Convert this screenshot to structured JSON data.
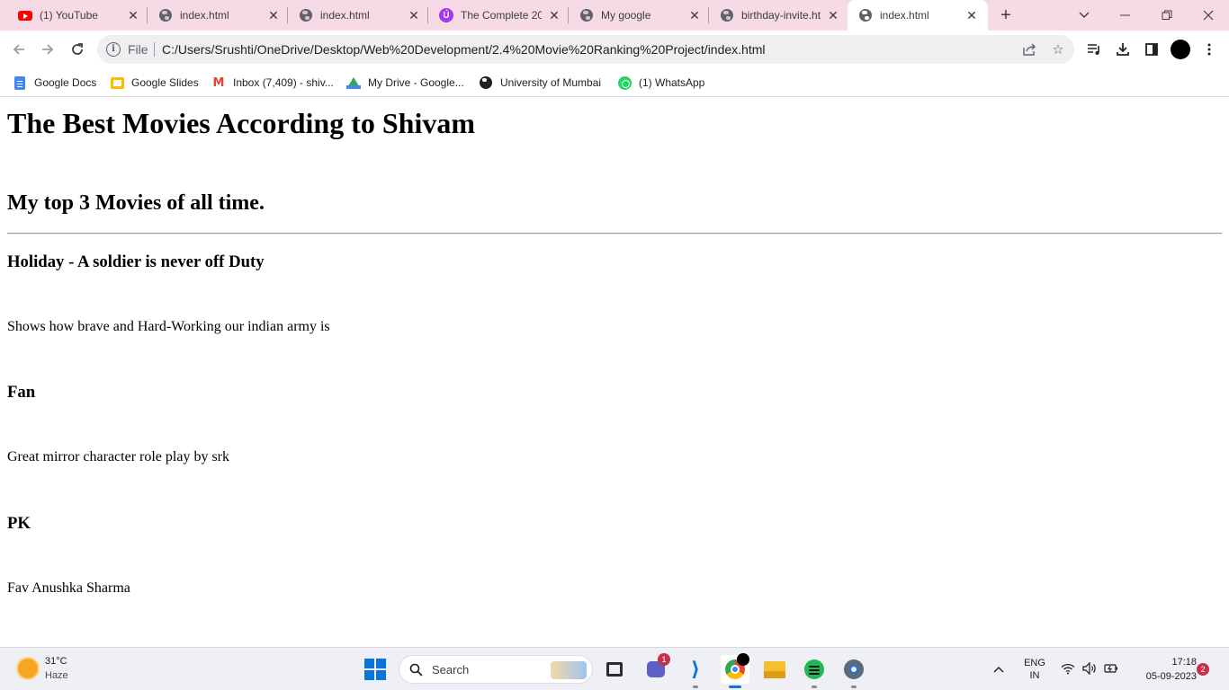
{
  "browser": {
    "tabs": [
      {
        "title": "(1) YouTube",
        "icon": "youtube-icon"
      },
      {
        "title": "index.html",
        "icon": "globe-icon"
      },
      {
        "title": "index.html",
        "icon": "globe-icon"
      },
      {
        "title": "The Complete 20",
        "icon": "udemy-icon"
      },
      {
        "title": "My google",
        "icon": "globe-icon"
      },
      {
        "title": "birthday-invite.ht",
        "icon": "globe-icon"
      },
      {
        "title": "index.html",
        "icon": "globe-icon",
        "active": true
      }
    ],
    "new_tab_glyph": "+",
    "address": {
      "scheme_label": "File",
      "url": "C:/Users/Srushti/OneDrive/Desktop/Web%20Development/2.4%20Movie%20Ranking%20Project/index.html"
    },
    "bookmarks": [
      {
        "label": "Google Docs",
        "icon": "google-docs-icon"
      },
      {
        "label": "Google Slides",
        "icon": "google-slides-icon"
      },
      {
        "label": "Inbox (7,409) - shiv...",
        "icon": "gmail-icon"
      },
      {
        "label": "My Drive - Google...",
        "icon": "google-drive-icon"
      },
      {
        "label": "University of Mumbai",
        "icon": "globe-icon"
      },
      {
        "label": "(1) WhatsApp",
        "icon": "whatsapp-icon"
      }
    ]
  },
  "page": {
    "title": "The Best Movies According to Shivam",
    "subtitle": "My top 3 Movies of all time.",
    "movies": [
      {
        "name": "Holiday - A soldier is never off Duty",
        "description": "Shows how brave and Hard-Working our indian army is"
      },
      {
        "name": "Fan",
        "description": "Great mirror character role play by srk"
      },
      {
        "name": "PK",
        "description": "Fav Anushka Sharma"
      }
    ]
  },
  "taskbar": {
    "weather": {
      "temp": "31°C",
      "condition": "Haze"
    },
    "search_placeholder": "Search",
    "teams_badge": "1",
    "language": {
      "line1": "ENG",
      "line2": "IN"
    },
    "time": "17:18",
    "date": "05-09-2023",
    "notification_count": "2"
  },
  "colors": {
    "tab_strip": "#f6dbe7",
    "omnibox": "#efeef0",
    "taskbar": "#eef0f5",
    "accent": "#0a74da"
  }
}
